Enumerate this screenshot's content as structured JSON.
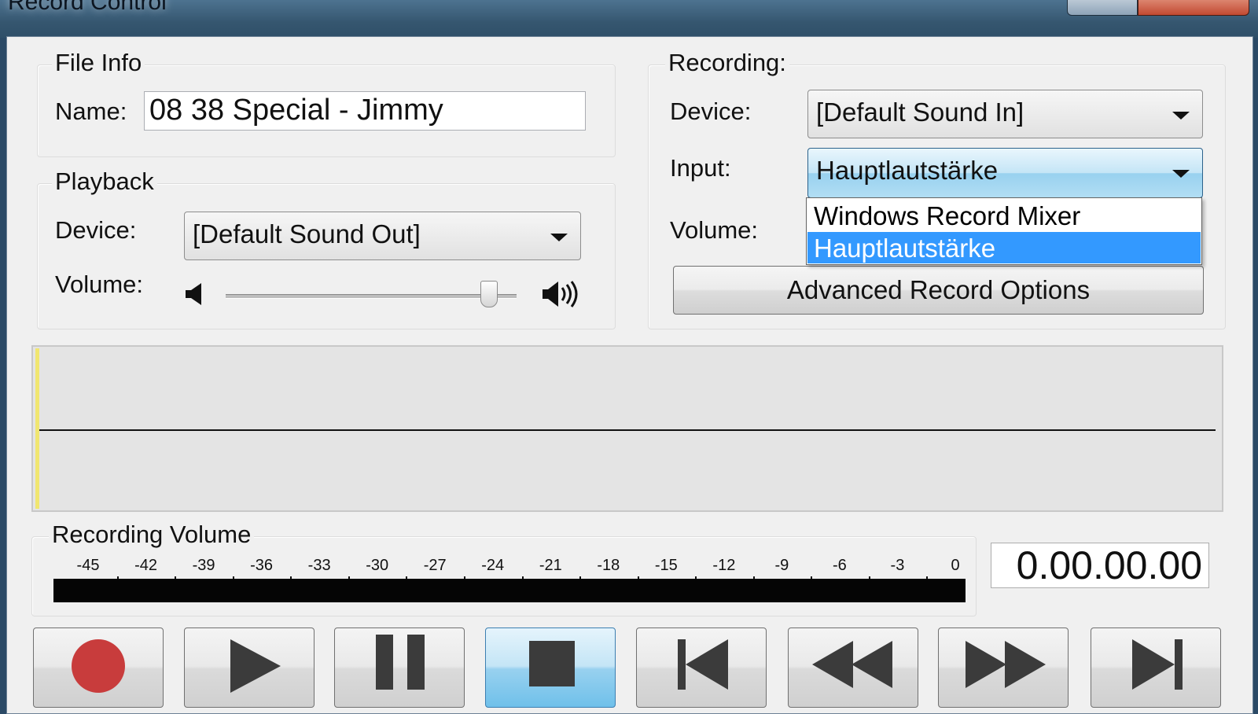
{
  "window": {
    "title": "Record Control"
  },
  "file_info": {
    "legend": "File Info",
    "name_label": "Name:",
    "name_value": "08  38 Special - Jimmy"
  },
  "playback": {
    "legend": "Playback",
    "device_label": "Device:",
    "device_value": "[Default Sound Out]",
    "volume_label": "Volume:",
    "volume_level": 0.93
  },
  "recording": {
    "legend": "Recording:",
    "device_label": "Device:",
    "device_value": "[Default Sound In]",
    "input_label": "Input:",
    "input_value": "Hauptlautstärke",
    "input_options": [
      "Windows Record Mixer",
      "Hauptlautstärke"
    ],
    "input_selected_index": 1,
    "volume_label": "Volume:",
    "advanced_button": "Advanced Record Options"
  },
  "recording_volume": {
    "legend": "Recording Volume",
    "scale": [
      "-45",
      "-42",
      "-39",
      "-36",
      "-33",
      "-30",
      "-27",
      "-24",
      "-21",
      "-18",
      "-15",
      "-12",
      "-9",
      "-6",
      "-3",
      "0"
    ]
  },
  "time_display": "0.00.00.00",
  "transport": {
    "buttons": [
      "record",
      "play",
      "pause",
      "stop",
      "skip-to-start",
      "rewind",
      "fast-forward",
      "skip-to-end"
    ],
    "active": "stop"
  },
  "colors": {
    "record": "#c83c3c",
    "icon": "#3b3b3b",
    "selection": "#3399ff",
    "waveform_cursor": "#f0e670"
  }
}
